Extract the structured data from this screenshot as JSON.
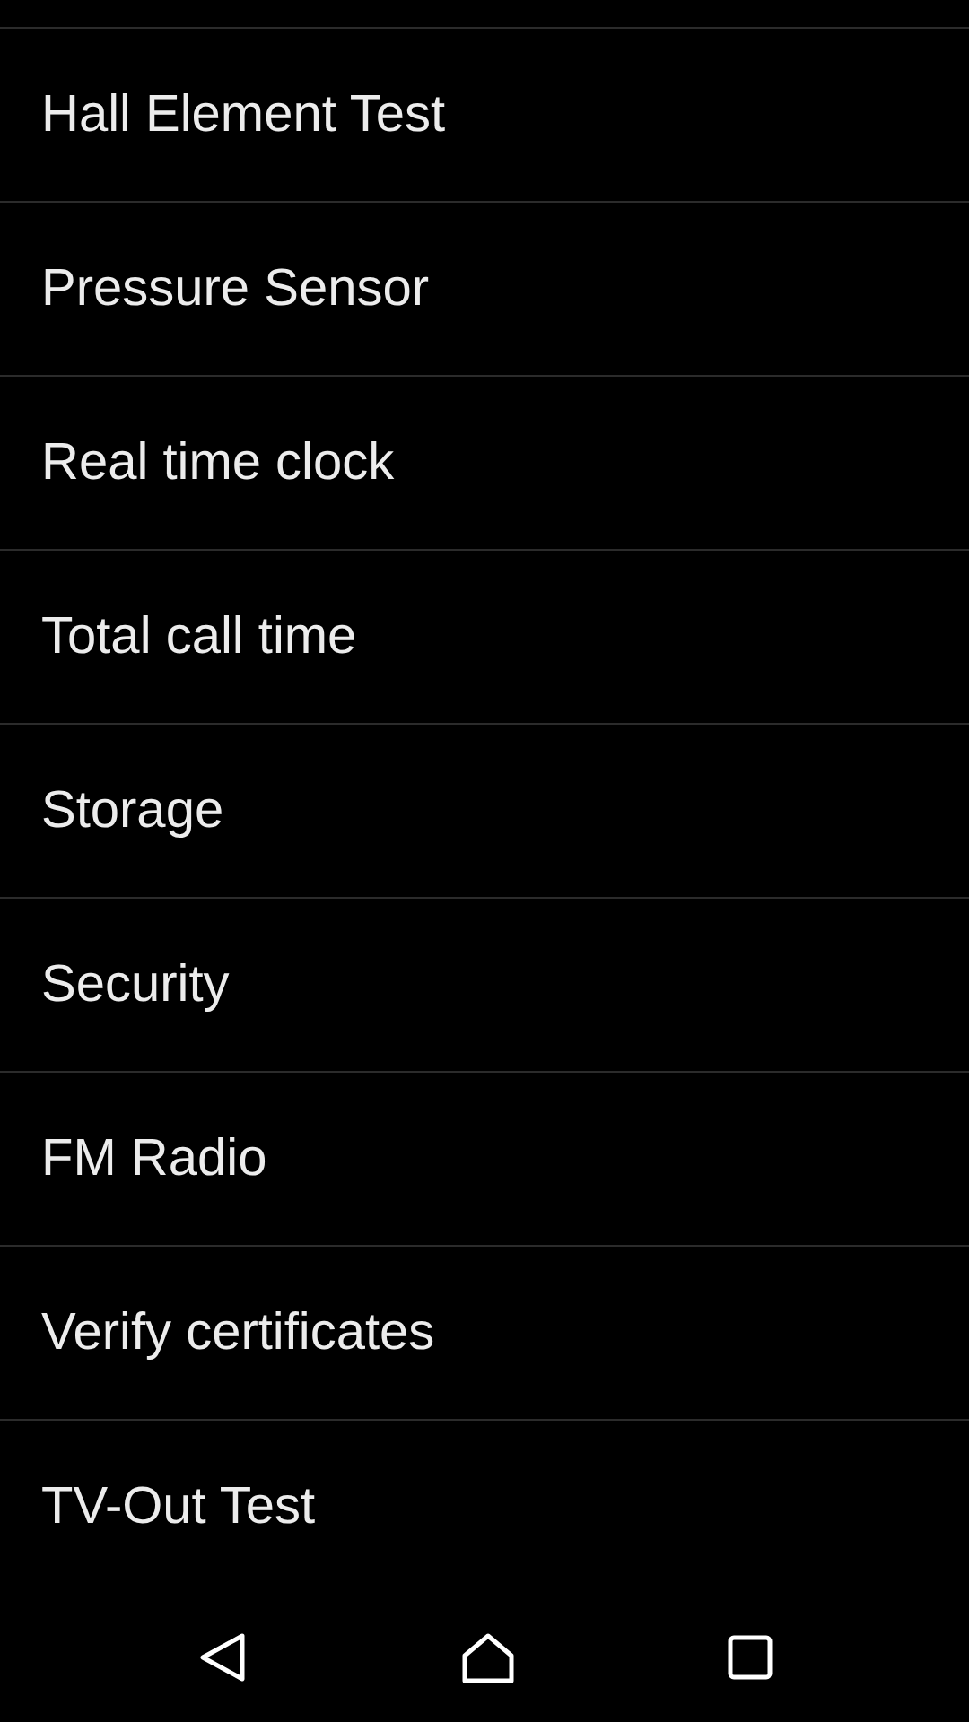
{
  "items": [
    {
      "label": "Hall Element Test"
    },
    {
      "label": "Pressure Sensor"
    },
    {
      "label": "Real time clock"
    },
    {
      "label": "Total call time"
    },
    {
      "label": "Storage"
    },
    {
      "label": "Security"
    },
    {
      "label": "FM Radio"
    },
    {
      "label": "Verify certificates"
    },
    {
      "label": "TV-Out Test"
    }
  ]
}
